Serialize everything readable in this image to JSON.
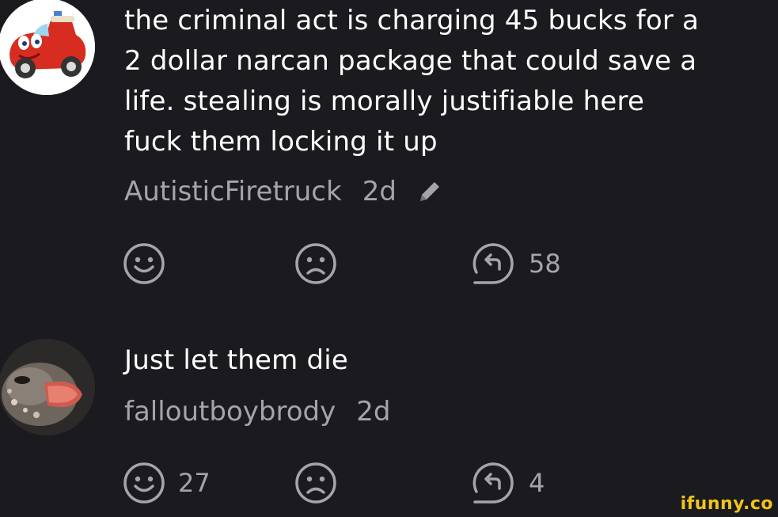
{
  "comments": [
    {
      "text": "the criminal act is charging 45 bucks for a\n2 dollar narcan package that could save a\nlife. stealing is morally justifiable here\nfuck them locking it up",
      "username": "AutisticFiretruck",
      "time": "2d",
      "edited_icon": "pencil-icon",
      "avatar": "firetruck-avatar",
      "smile_count": "",
      "frown_count": "",
      "reply_count": "58"
    },
    {
      "text": "Just let them die",
      "username": "falloutboybrody",
      "time": "2d",
      "avatar": "bird-avatar",
      "smile_count": "27",
      "frown_count": "",
      "reply_count": "4"
    }
  ],
  "watermark": "ifunny.co",
  "colors": {
    "background": "#1b1a1f",
    "text": "#ffffff",
    "secondary_text": "#a6a4aa",
    "watermark": "#f0c419"
  }
}
